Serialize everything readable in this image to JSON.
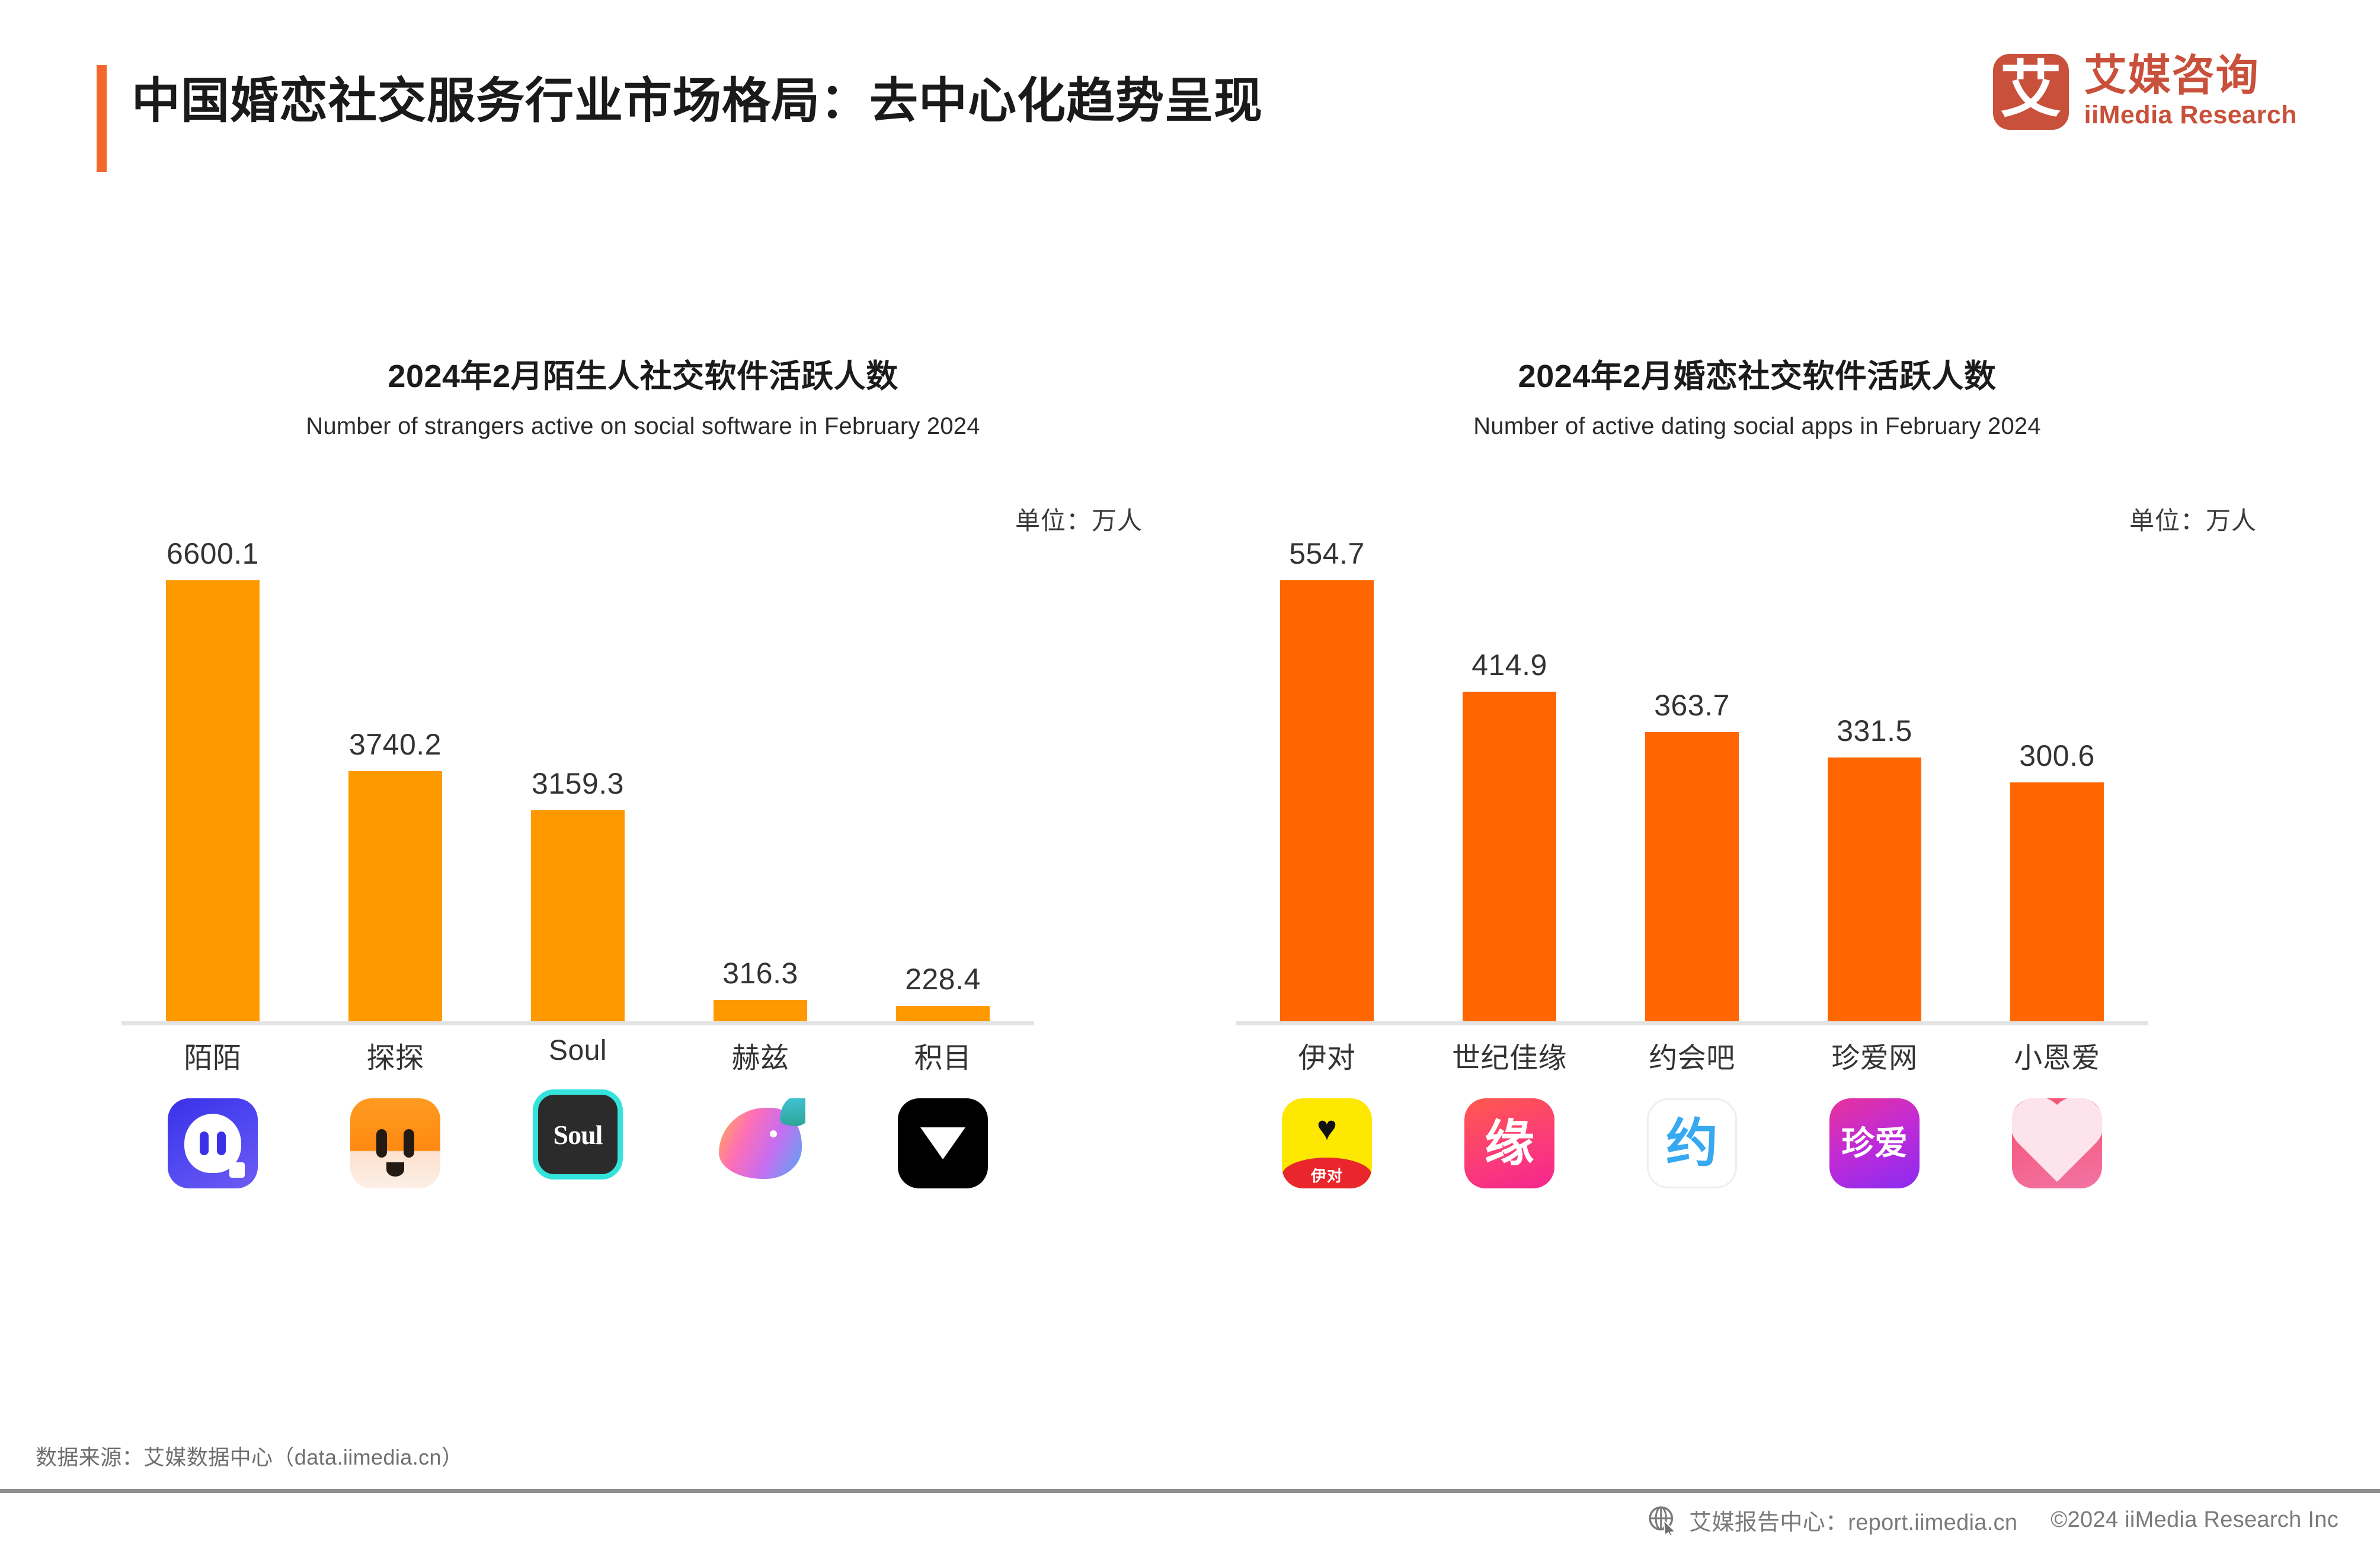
{
  "header": {
    "title": "中国婚恋社交服务行业市场格局：去中心化趋势呈现",
    "accent_color": "#F4672C",
    "logo": {
      "glyph": "艾",
      "name_cn": "艾媒咨询",
      "name_en": "iiMedia Research",
      "color": "#C9503A"
    }
  },
  "footer": {
    "source": "数据来源：艾媒数据中心（data.iimedia.cn）",
    "report_center": "艾媒报告中心：report.iimedia.cn",
    "copyright": "©2024  iiMedia Research Inc",
    "globe_icon": "globe-cursor-icon"
  },
  "chart_data": [
    {
      "type": "bar",
      "panel": "left",
      "title": "2024年2月陌生人社交软件活跃人数",
      "subtitle": "Number of strangers active on social software in February 2024",
      "unit": "单位：万人",
      "xlabel": "",
      "ylabel": "",
      "ylim": [
        0,
        6600.1
      ],
      "grid": false,
      "legend": "none",
      "bar_color": "#FF9900",
      "categories": [
        "陌陌",
        "探探",
        "Soul",
        "赫兹",
        "积目"
      ],
      "values": [
        6600.1,
        3740.2,
        3159.3,
        316.3,
        228.4
      ],
      "value_labels": [
        "6600.1",
        "3740.2",
        "3159.3",
        "316.3",
        "228.4"
      ],
      "icons": [
        "momo-app-icon",
        "tantan-app-icon",
        "soul-app-icon",
        "hertz-app-icon",
        "jimu-app-icon"
      ]
    },
    {
      "type": "bar",
      "panel": "right",
      "title": "2024年2月婚恋社交软件活跃人数",
      "subtitle": "Number of active dating social apps in February 2024",
      "unit": "单位：万人",
      "xlabel": "",
      "ylabel": "",
      "ylim": [
        0,
        554.7
      ],
      "grid": false,
      "legend": "none",
      "bar_color": "#FF6600",
      "categories": [
        "伊对",
        "世纪佳缘",
        "约会吧",
        "珍爱网",
        "小恩爱"
      ],
      "values": [
        554.7,
        414.9,
        363.7,
        331.5,
        300.6
      ],
      "value_labels": [
        "554.7",
        "414.9",
        "363.7",
        "331.5",
        "300.6"
      ],
      "icons": [
        "yidui-app-icon",
        "shijijiayuan-app-icon",
        "yuehuiba-app-icon",
        "zhenaiwang-app-icon",
        "xiaoenai-app-icon"
      ]
    }
  ],
  "icon_art": {
    "yidui_mark": "♥",
    "yidui_pill": "伊对",
    "jiayuan_char": "缘",
    "yuehui_char": "约",
    "zhenai_char": "珍爱",
    "soul_text": "Soul"
  }
}
